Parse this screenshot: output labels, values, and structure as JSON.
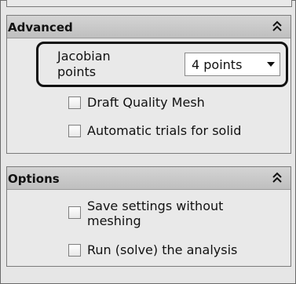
{
  "advanced": {
    "title": "Advanced",
    "collapse_icon": "chevron-double-up-icon",
    "jacobian": {
      "label_line1": "Jacobian",
      "label_line2": "points",
      "selected": "4 points"
    },
    "draft_quality_mesh": {
      "label": "Draft Quality Mesh",
      "checked": false
    },
    "automatic_trials": {
      "label": "Automatic trials for solid",
      "checked": false
    }
  },
  "options": {
    "title": "Options",
    "collapse_icon": "chevron-double-up-icon",
    "save_settings": {
      "label_line1": "Save settings without",
      "label_line2": "meshing",
      "checked": false
    },
    "run_analysis": {
      "label": "Run (solve) the analysis",
      "checked": false
    }
  }
}
